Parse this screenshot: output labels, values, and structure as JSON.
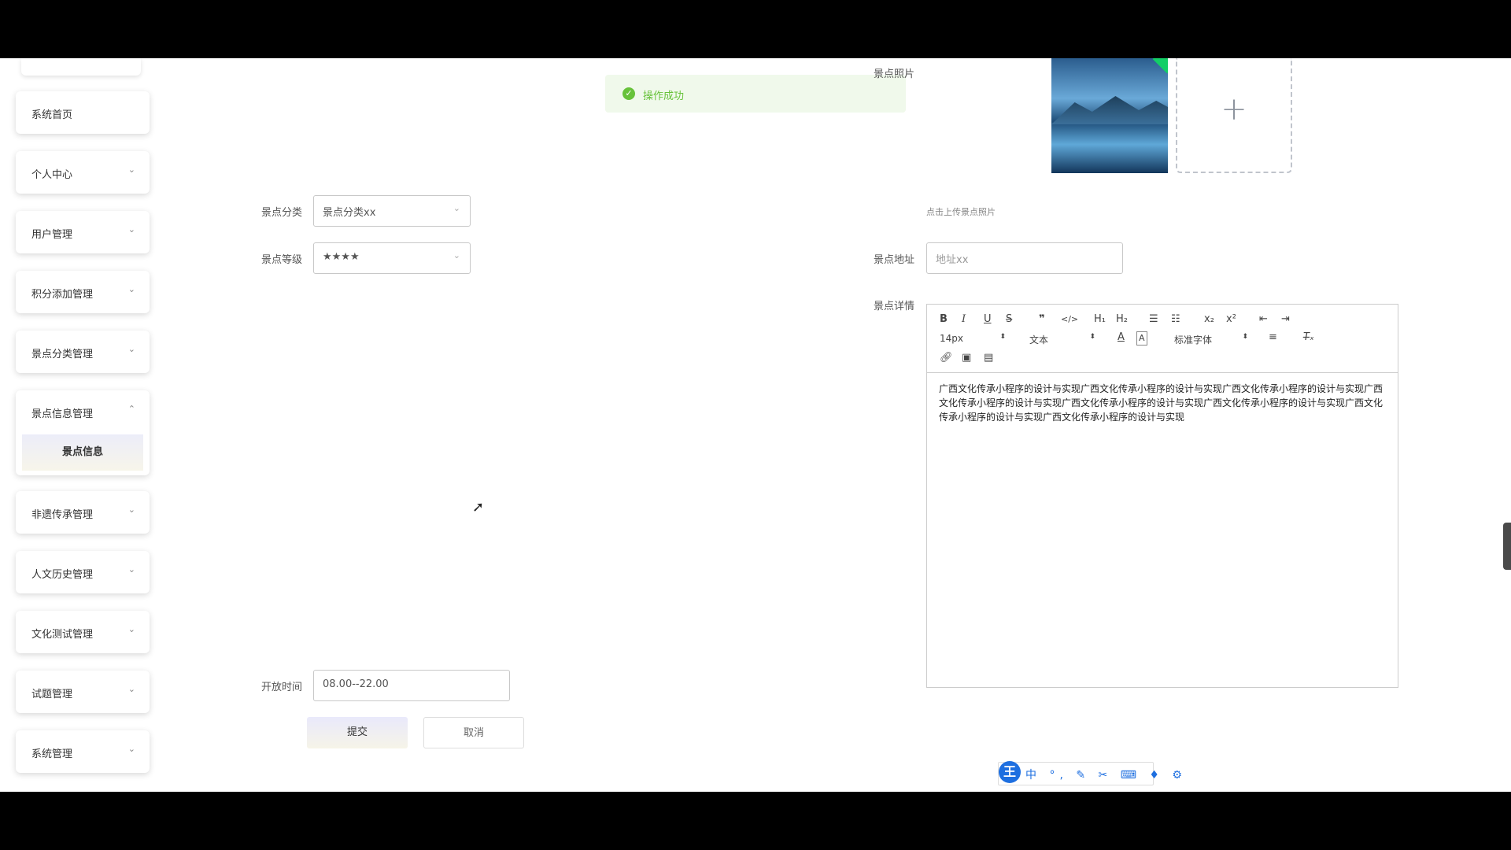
{
  "toast": {
    "message": "操作成功"
  },
  "sidebar": {
    "items": [
      {
        "label": "系统首页",
        "has_chevron": false
      },
      {
        "label": "个人中心",
        "has_chevron": true
      },
      {
        "label": "用户管理",
        "has_chevron": true
      },
      {
        "label": "积分添加管理",
        "has_chevron": true
      },
      {
        "label": "景点分类管理",
        "has_chevron": true
      },
      {
        "label": "景点信息管理",
        "has_chevron": true,
        "expanded": true,
        "children": [
          "景点信息"
        ]
      },
      {
        "label": "非遗传承管理",
        "has_chevron": true
      },
      {
        "label": "人文历史管理",
        "has_chevron": true
      },
      {
        "label": "文化测试管理",
        "has_chevron": true
      },
      {
        "label": "试题管理",
        "has_chevron": true
      },
      {
        "label": "系统管理",
        "has_chevron": true
      }
    ]
  },
  "form": {
    "category": {
      "label": "景点分类",
      "value": "景点分类xx"
    },
    "level": {
      "label": "景点等级",
      "value": "★★★★"
    },
    "photo": {
      "label": "景点照片",
      "hint": "点击上传景点照片"
    },
    "address": {
      "label": "景点地址",
      "placeholder": "地址xx"
    },
    "detail": {
      "label": "景点详情",
      "content": "广西文化传承小程序的设计与实现广西文化传承小程序的设计与实现广西文化传承小程序的设计与实现广西文化传承小程序的设计与实现广西文化传承小程序的设计与实现广西文化传承小程序的设计与实现广西文化传承小程序的设计与实现广西文化传承小程序的设计与实现"
    },
    "open_time": {
      "label": "开放时间",
      "value": "08.00--22.00"
    },
    "submit_label": "提交",
    "cancel_label": "取消"
  },
  "editor_toolbar": {
    "font_size": "14px",
    "format": "文本",
    "font_family": "标准字体",
    "row1": [
      "bold",
      "italic",
      "underline",
      "strike",
      "blockquote",
      "code-block",
      "header-1",
      "header-2",
      "ordered-list",
      "bullet-list",
      "subscript",
      "superscript",
      "outdent",
      "indent"
    ],
    "row2": [
      "font-size",
      "header-format",
      "font-color",
      "background-color",
      "font-family",
      "align",
      "clean"
    ],
    "row3": [
      "link",
      "image",
      "video"
    ]
  },
  "ime_toolbar": {
    "logo": "王",
    "mode": "中"
  },
  "colors": {
    "success": "#67c23a",
    "ime_blue": "#1e6fe0"
  }
}
